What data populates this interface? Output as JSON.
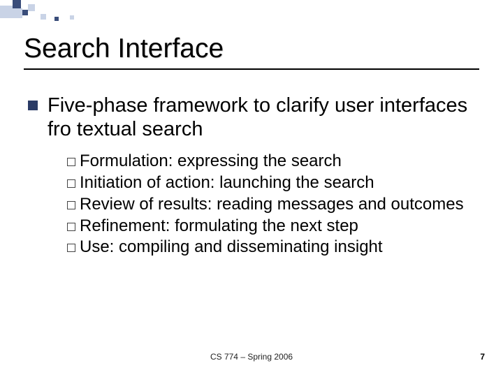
{
  "title": "Search Interface",
  "level1_text": "Five-phase framework to clarify user interfaces fro textual search",
  "level2": [
    "Formulation: expressing the search",
    "Initiation of action: launching the search",
    "Review of results: reading messages and outcomes",
    "Refinement: formulating the next step",
    "Use: compiling and disseminating insight"
  ],
  "footer": {
    "center": "CS 774 – Spring 2006",
    "page": "7"
  }
}
